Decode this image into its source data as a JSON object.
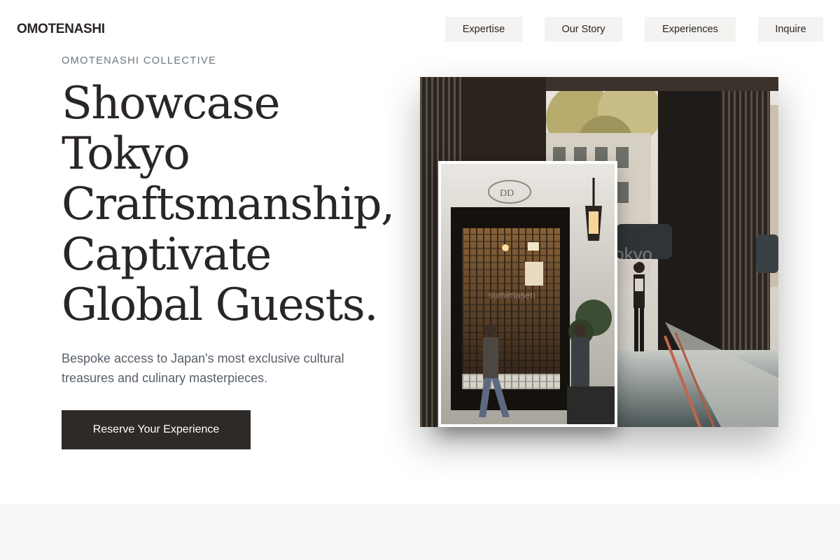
{
  "brand": {
    "name": "OMOTENASHI"
  },
  "nav": {
    "items": [
      {
        "label": "Expertise"
      },
      {
        "label": "Our Story"
      },
      {
        "label": "Experiences"
      },
      {
        "label": "Inquire"
      }
    ]
  },
  "hero": {
    "eyebrow": "OMOTENASHI COLLECTIVE",
    "headline_lines": [
      "Showcase",
      "Tokyo",
      "Craftsmanship,",
      "Captivate",
      "Global Guests."
    ],
    "subtitle": "Bespoke access to Japan's most exclusive cultural treasures and culinary masterpieces.",
    "cta_label": "Reserve Your Experience"
  },
  "images": {
    "main_watermark": "tokyo",
    "inset_watermark": "sumimasen"
  },
  "colors": {
    "text_dark": "#2a2624",
    "nav_bg": "#f4f3f1",
    "eyebrow": "#6b7680",
    "subtitle": "#58606a",
    "cta_bg": "#2e2a27",
    "band_bg": "#f8f7f5"
  }
}
